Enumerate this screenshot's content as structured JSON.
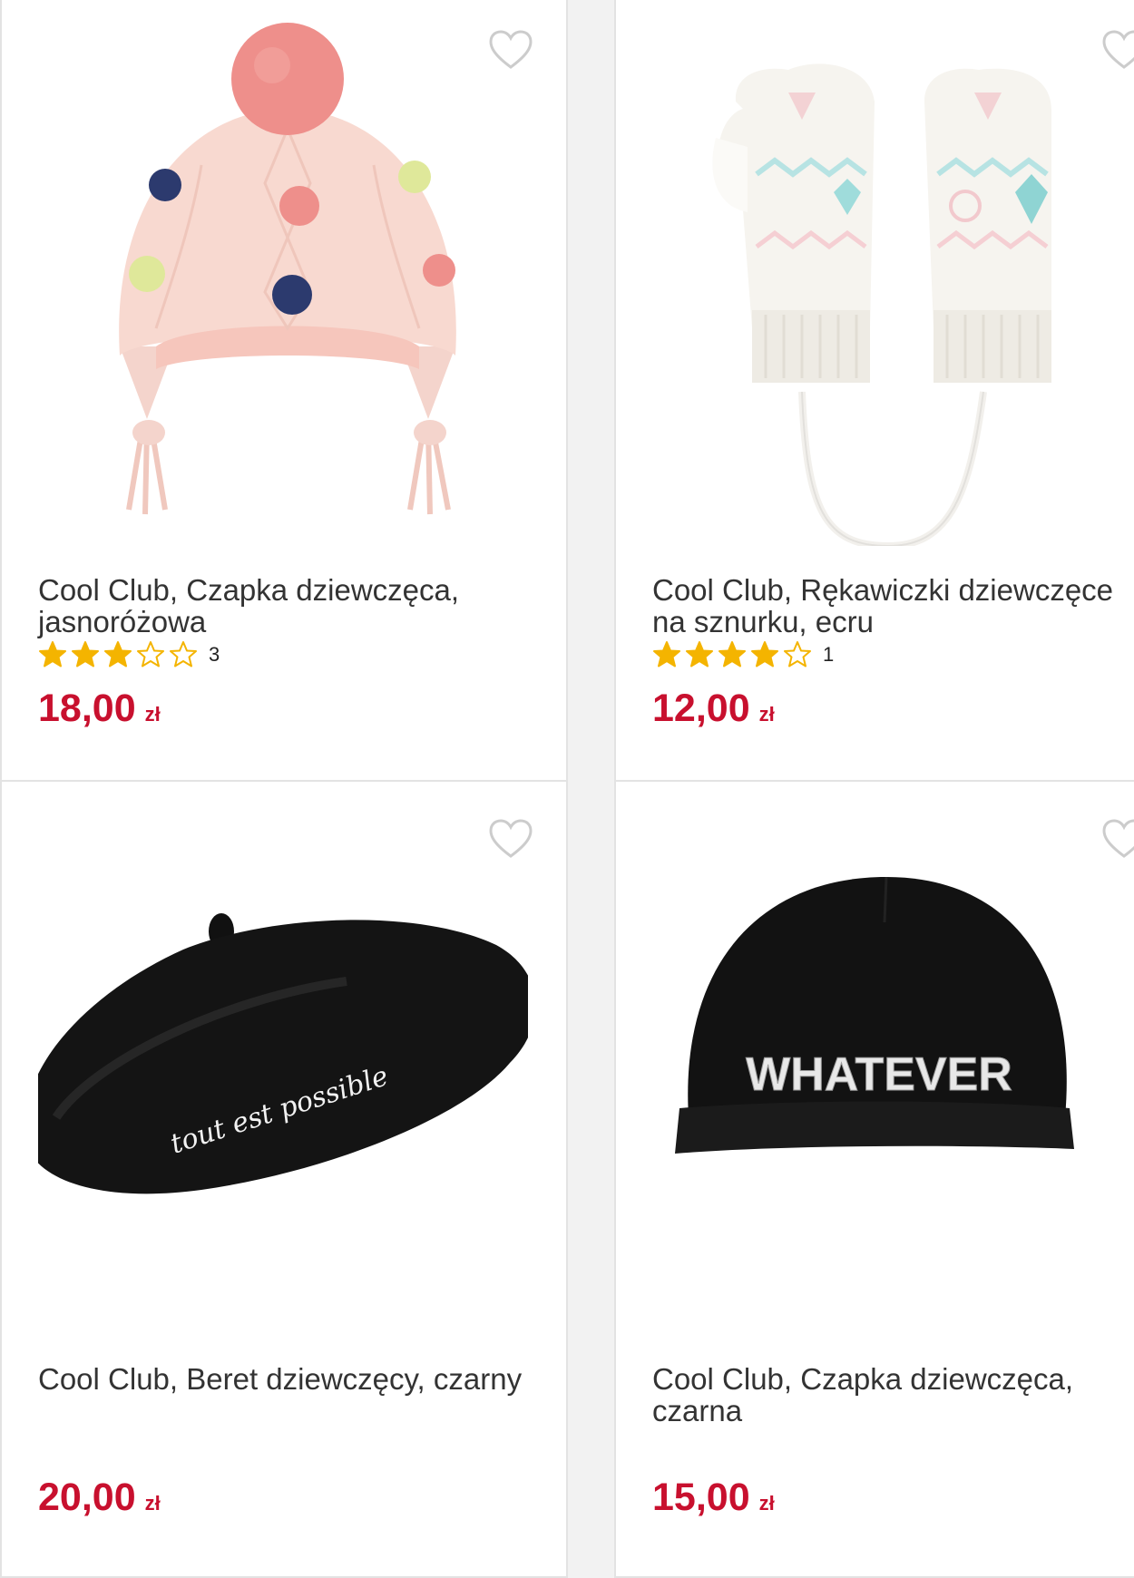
{
  "products": [
    {
      "title": "Cool Club, Czapka dziewczęca, jasnoróżowa",
      "rating_stars": 3,
      "rating_max": 5,
      "rating_count": "3",
      "price": "18,00",
      "currency": "zł",
      "image_icon": "pompom-winter-hat-icon"
    },
    {
      "title": "Cool Club, Rękawiczki dziewczęce na sznurku, ecru",
      "rating_stars": 4,
      "rating_max": 5,
      "rating_count": "1",
      "price": "12,00",
      "currency": "zł",
      "image_icon": "mittens-icon"
    },
    {
      "title": "Cool Club, Beret dziewczęcy, czarny",
      "price": "20,00",
      "currency": "zł",
      "image_text": "tout est possible",
      "image_icon": "beret-icon"
    },
    {
      "title": "Cool Club, Czapka dziewczęca, czarna",
      "price": "15,00",
      "currency": "zł",
      "image_text": "WHATEVER",
      "image_icon": "beanie-icon"
    }
  ],
  "colors": {
    "price": "#c8102e",
    "star_filled": "#f4b400",
    "heart_outline": "#cccccc"
  }
}
